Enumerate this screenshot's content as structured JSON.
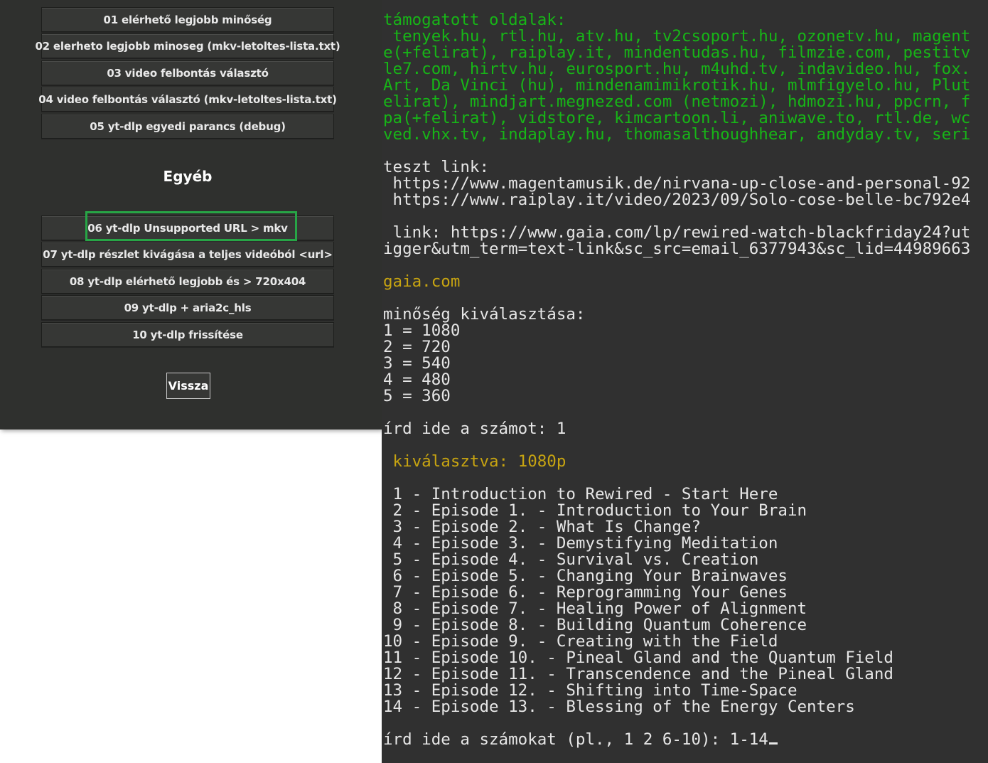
{
  "menu": {
    "items_top": [
      "01 elérhető legjobb minőség",
      "02 elerheto legjobb minoseg (mkv-letoltes-lista.txt)",
      "03 video felbontás választó",
      "04 video felbontás választó (mkv-letoltes-lista.txt)",
      "05 yt-dlp egyedi parancs (debug)"
    ],
    "section_title": "Egyéb",
    "items_other": [
      "06 yt-dlp Unsupported URL > mkv",
      "07 yt-dlp részlet kivágása a teljes videóból <url>",
      "08 yt-dlp elérhető legjobb és > 720x404",
      "09 yt-dlp + aria2c_hls",
      "10 yt-dlp frissítése"
    ],
    "back_label": "Vissza",
    "highlight_color": "#27a546"
  },
  "terminal": {
    "supported_sites_lines": [
      "támogatott oldalak:",
      " tenyek.hu, rtl.hu, atv.hu, tv2csoport.hu, ozonetv.hu, magent",
      "e(+felirat), raiplay.it, mindentudas.hu, filmzie.com, pestitv",
      "le7.com, hirtv.hu, eurosport.hu, m4uhd.tv, indavideo.hu, fox.",
      "Art, Da Vinci (hu), mindenamimikrotik.hu, mlmfigyelo.hu, Plut",
      "elirat), mindjart.megnezed.com (netmozi), hdmozi.hu, ppcrn, f",
      "pa(+felirat), vidstore, kimcartoon.li, aniwave.to, rtl.de, wc",
      "ved.vhx.tv, indaplay.hu, thomasalthoughhear, andyday.tv, seri"
    ],
    "test_link_lines": [
      "teszt link:",
      " https://www.magentamusik.de/nirvana-up-close-and-personal-92",
      " https://www.raiplay.it/video/2023/09/Solo-cose-belle-bc792e4"
    ],
    "link_lines": [
      " link: https://www.gaia.com/lp/rewired-watch-blackfriday24?ut",
      "igger&utm_term=text-link&sc_src=email_6377943&sc_lid=44989663"
    ],
    "site_name": "gaia.com",
    "quality_prompt": "minőség kiválasztása:",
    "quality_options": [
      "1 = 1080",
      "2 = 720",
      "3 = 540",
      "4 = 480",
      "5 = 360"
    ],
    "number_prompt": "írd ide a számot: 1",
    "selected": " kiválasztva: 1080p",
    "episodes": [
      " 1 - Introduction to Rewired - Start Here",
      " 2 - Episode 1. - Introduction to Your Brain",
      " 3 - Episode 2. - What Is Change?",
      " 4 - Episode 3. - Demystifying Meditation",
      " 5 - Episode 4. - Survival vs. Creation",
      " 6 - Episode 5. - Changing Your Brainwaves",
      " 7 - Episode 6. - Reprogramming Your Genes",
      " 8 - Episode 7. - Healing Power of Alignment",
      " 9 - Episode 8. - Building Quantum Coherence",
      "10 - Episode 9. - Creating with the Field",
      "11 - Episode 10. - Pineal Gland and the Quantum Field",
      "12 - Episode 11. - Transcendence and the Pineal Gland",
      "13 - Episode 12. - Shifting into Time-Space",
      "14 - Episode 13. - Blessing of the Energy Centers"
    ],
    "numbers_prompt": "írd ide a számokat (pl., 1 2 6-10): 1-14",
    "colors": {
      "green": "#17b517",
      "yellow": "#c7a411",
      "text": "#e6e6e6",
      "background": "#303030"
    }
  }
}
